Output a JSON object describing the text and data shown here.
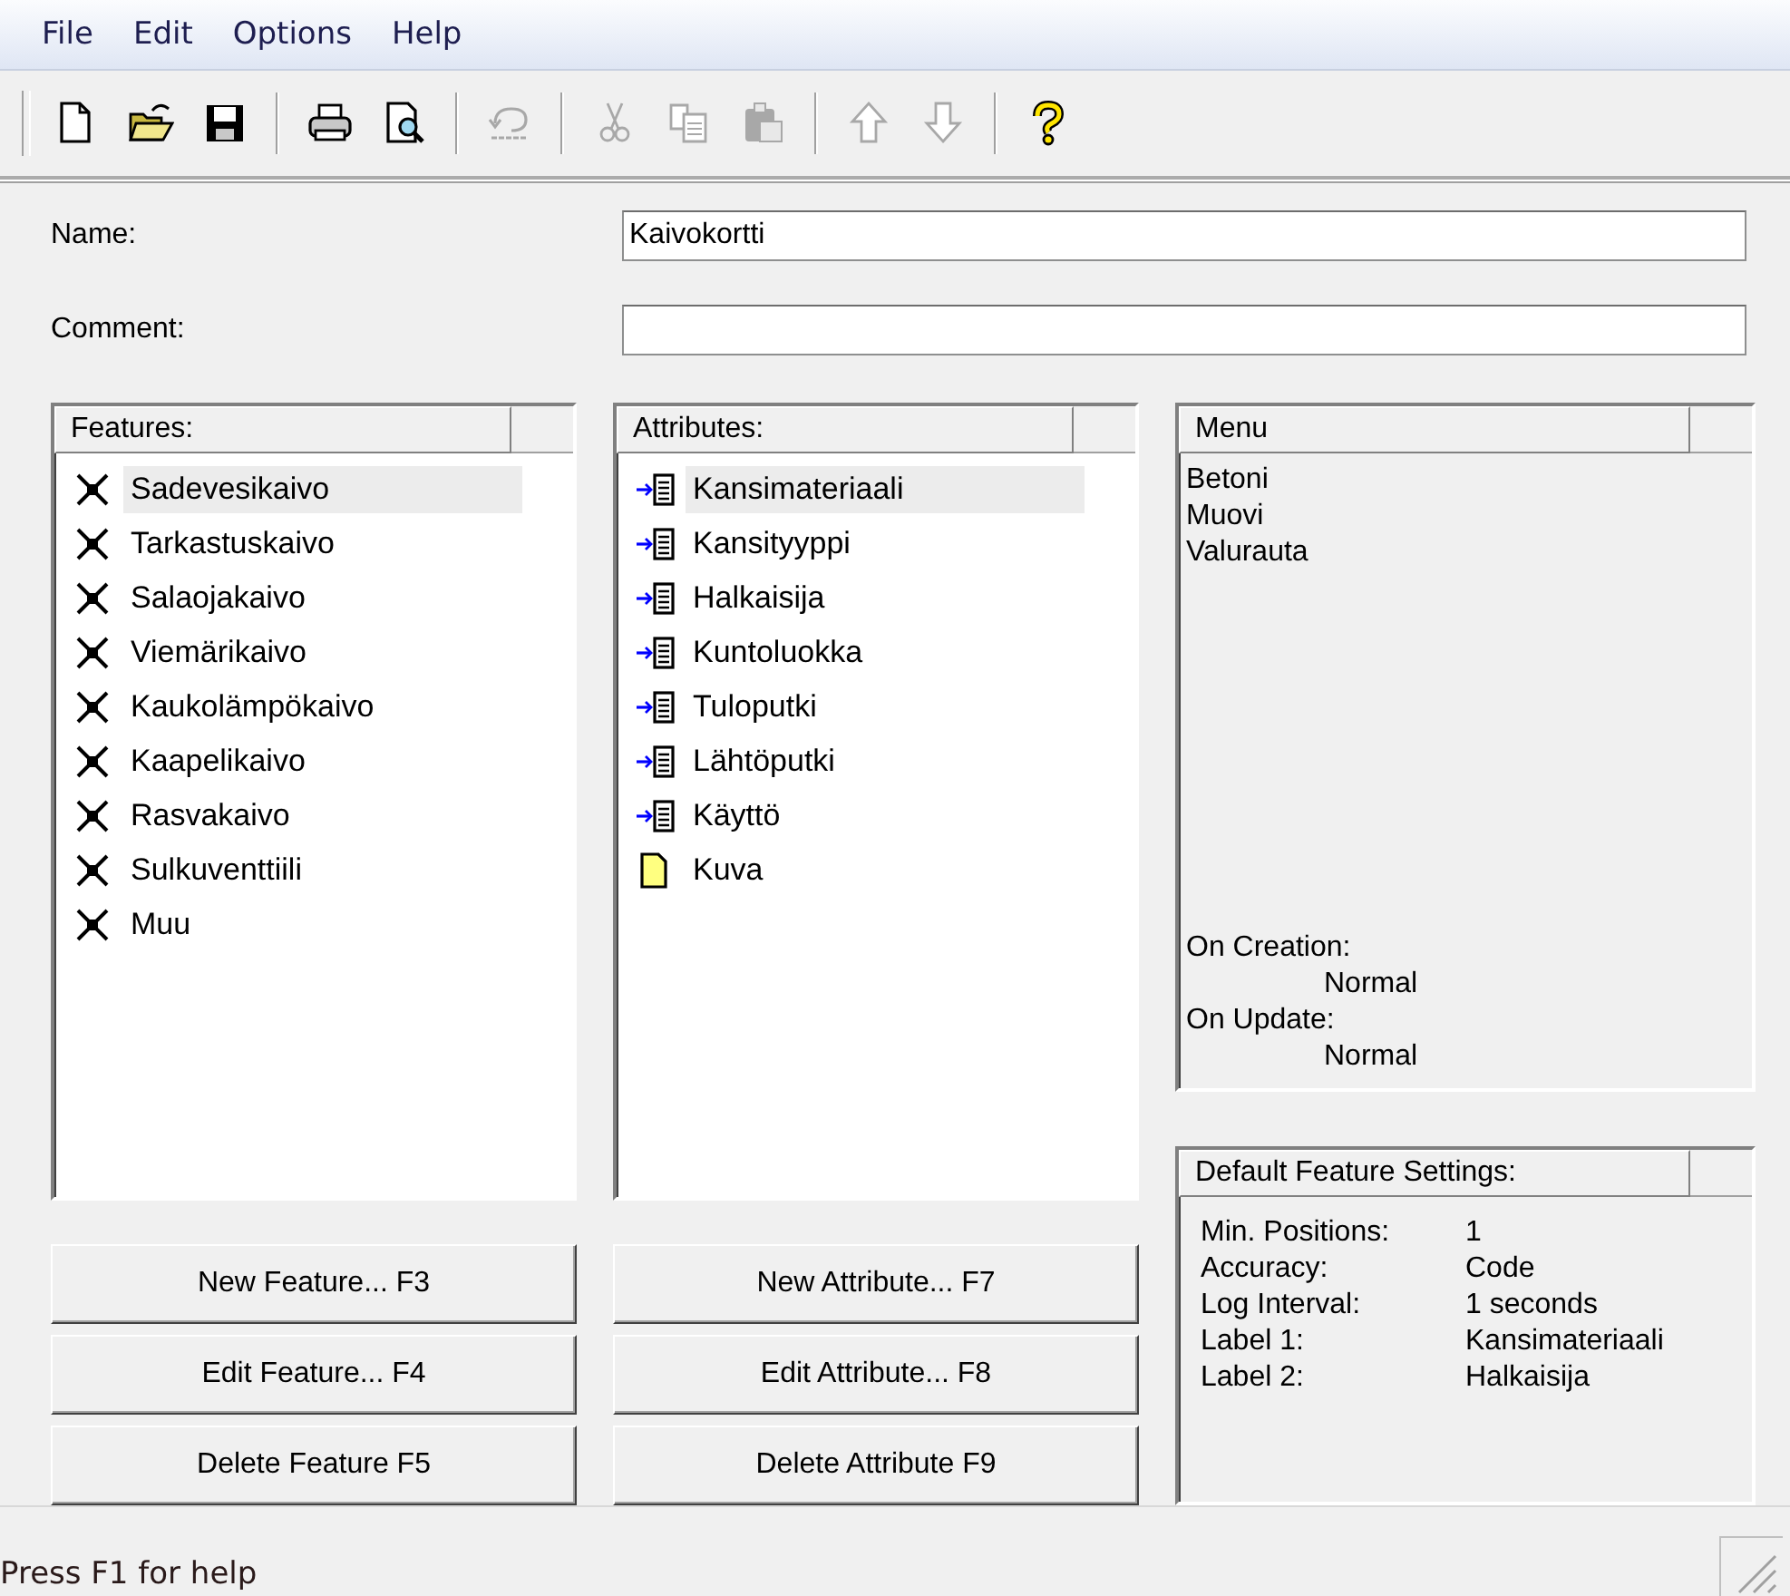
{
  "menu_bar": [
    "File",
    "Edit",
    "Options",
    "Help"
  ],
  "toolbar": [
    {
      "kind": "new",
      "disabled": false
    },
    {
      "kind": "open",
      "disabled": false
    },
    {
      "kind": "save",
      "disabled": false
    },
    {
      "kind": "separator"
    },
    {
      "kind": "print",
      "disabled": false
    },
    {
      "kind": "preview",
      "disabled": false
    },
    {
      "kind": "separator"
    },
    {
      "kind": "undo",
      "disabled": true
    },
    {
      "kind": "separator"
    },
    {
      "kind": "cut",
      "disabled": true
    },
    {
      "kind": "copy",
      "disabled": true
    },
    {
      "kind": "paste",
      "disabled": true
    },
    {
      "kind": "separator"
    },
    {
      "kind": "up",
      "disabled": true
    },
    {
      "kind": "down",
      "disabled": true
    },
    {
      "kind": "separator"
    },
    {
      "kind": "help",
      "disabled": false
    }
  ],
  "name_field": {
    "label": "Name:",
    "value": "Kaivokortti"
  },
  "comment_field": {
    "label": "Comment:"
  },
  "features": {
    "header": "Features:",
    "items": [
      {
        "label": "Sadevesikaivo",
        "selected": true
      },
      {
        "label": "Tarkastuskaivo",
        "selected": false
      },
      {
        "label": "Salaojakaivo",
        "selected": false
      },
      {
        "label": "Viemärikaivo",
        "selected": false
      },
      {
        "label": "Kaukolämpökaivo",
        "selected": false
      },
      {
        "label": "Kaapelikaivo",
        "selected": false
      },
      {
        "label": "Rasvakaivo",
        "selected": false
      },
      {
        "label": "Sulkuventtiili",
        "selected": false
      },
      {
        "label": "Muu",
        "selected": false
      }
    ]
  },
  "attributes": {
    "header": "Attributes:",
    "items": [
      {
        "label": "Kansimateriaali",
        "kind": "menu",
        "selected": true
      },
      {
        "label": "Kansityyppi",
        "kind": "menu",
        "selected": false
      },
      {
        "label": "Halkaisija",
        "kind": "menu",
        "selected": false
      },
      {
        "label": "Kuntoluokka",
        "kind": "menu",
        "selected": false
      },
      {
        "label": "Tuloputki",
        "kind": "menu",
        "selected": false
      },
      {
        "label": "Lähtöputki",
        "kind": "menu",
        "selected": false
      },
      {
        "label": "Käyttö",
        "kind": "menu",
        "selected": false
      },
      {
        "label": "Kuva",
        "kind": "file",
        "selected": false
      }
    ]
  },
  "menu_panel": {
    "header": "Menu",
    "options": [
      "Betoni",
      "Muovi",
      "Valurauta"
    ],
    "settings": [
      {
        "label": "On Creation:",
        "value": "Normal"
      },
      {
        "label": "On Update:",
        "value": "Normal"
      }
    ]
  },
  "default_settings": {
    "header": "Default Feature Settings:",
    "rows": [
      {
        "label": "Min. Positions:",
        "value": "1"
      },
      {
        "label": "Accuracy:",
        "value": "Code"
      },
      {
        "label": "Log Interval:",
        "value": "1 seconds"
      },
      {
        "label": "Label 1:",
        "value": "Kansimateriaali"
      },
      {
        "label": "Label 2:",
        "value": "Halkaisija"
      }
    ]
  },
  "feature_buttons": [
    "New Feature... F3",
    "Edit Feature... F4",
    "Delete Feature F5"
  ],
  "attribute_buttons": [
    "New Attribute... F7",
    "Edit Attribute... F8",
    "Delete Attribute F9"
  ],
  "status_bar": {
    "text": "Press F1 for help"
  }
}
